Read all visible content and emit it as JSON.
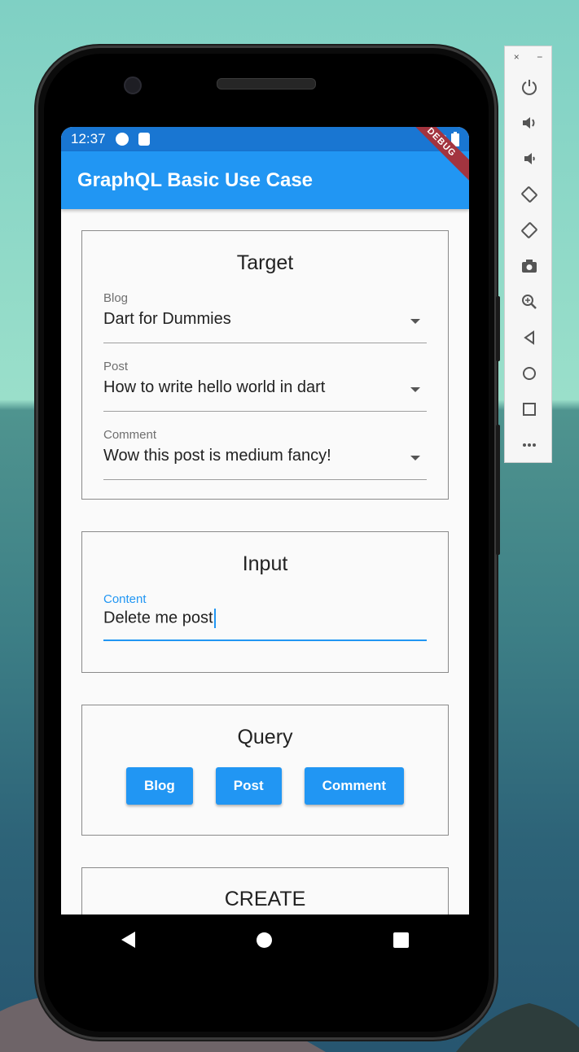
{
  "status_bar": {
    "time": "12:37"
  },
  "debug_banner": "DEBUG",
  "app_bar": {
    "title": "GraphQL Basic Use Case"
  },
  "target": {
    "title": "Target",
    "blog": {
      "label": "Blog",
      "value": "Dart for Dummies"
    },
    "post": {
      "label": "Post",
      "value": "How to write hello world in dart"
    },
    "comment": {
      "label": "Comment",
      "value": "Wow this post is medium fancy!"
    }
  },
  "input": {
    "title": "Input",
    "content": {
      "label": "Content",
      "value": "Delete me post"
    }
  },
  "query": {
    "title": "Query",
    "buttons": {
      "blog": "Blog",
      "post": "Post",
      "comment": "Comment"
    }
  },
  "create": {
    "title": "CREATE"
  },
  "emulator_toolbar": {
    "close": "×",
    "minimize": "−",
    "tools": [
      "power-icon",
      "volume-up-icon",
      "volume-down-icon",
      "rotate-left-icon",
      "rotate-right-icon",
      "camera-icon",
      "zoom-icon",
      "back-icon",
      "home-icon",
      "overview-icon",
      "more-icon"
    ]
  },
  "colors": {
    "primary": "#2196f3",
    "status_bar": "#1976d2",
    "debug": "#a3343f"
  }
}
